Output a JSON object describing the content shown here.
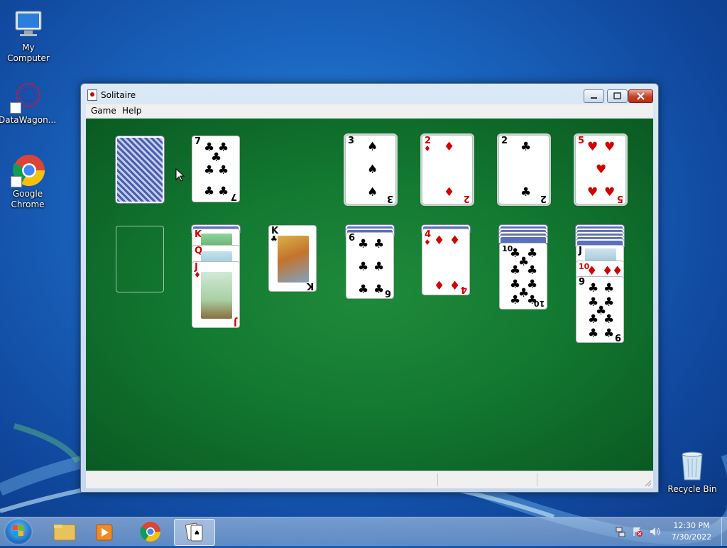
{
  "desktop": {
    "icons": [
      {
        "label": "My Computer",
        "icon": "computer-icon"
      },
      {
        "label": "DataWagon...",
        "icon": "datawagon-icon"
      },
      {
        "label": "Google Chrome",
        "icon": "chrome-icon"
      },
      {
        "label": "Recycle Bin",
        "icon": "recycle-bin-icon"
      }
    ]
  },
  "window": {
    "title": "Solitaire",
    "menu": [
      "Game",
      "Help"
    ]
  },
  "game": {
    "stock": {
      "face": "back"
    },
    "waste": {
      "rank": "7",
      "suit": "♣",
      "color": "#000000"
    },
    "foundations": [
      {
        "rank": "3",
        "suit": "♠",
        "color": "#000000"
      },
      {
        "rank": "2",
        "suit": "♦",
        "color": "#d40000"
      },
      {
        "rank": "2",
        "suit": "♣",
        "color": "#000000"
      },
      {
        "rank": "5",
        "suit": "♥",
        "color": "#d40000"
      }
    ],
    "tableau": [
      {
        "column": 1,
        "face_up": []
      },
      {
        "column": 2,
        "face_up": [
          {
            "rank": "K",
            "suit": "♥"
          },
          {
            "rank": "Q",
            "suit": "♥"
          },
          {
            "rank": "J",
            "suit": "♦"
          }
        ]
      },
      {
        "column": 3,
        "face_up": [
          {
            "rank": "K",
            "suit": "♣"
          }
        ]
      },
      {
        "column": 4,
        "face_up": [
          {
            "rank": "6",
            "suit": "♣"
          }
        ]
      },
      {
        "column": 5,
        "face_up": [
          {
            "rank": "4",
            "suit": "♦"
          }
        ]
      },
      {
        "column": 6,
        "face_up": [
          {
            "rank": "10",
            "suit": "♣"
          }
        ]
      },
      {
        "column": 7,
        "face_up": [
          {
            "rank": "J",
            "suit": "♠"
          },
          {
            "rank": "10",
            "suit": "♦"
          },
          {
            "rank": "9",
            "suit": "♣"
          }
        ]
      }
    ]
  },
  "taskbar": {
    "clock_time": "12:30 PM",
    "clock_date": "7/30/2022"
  }
}
